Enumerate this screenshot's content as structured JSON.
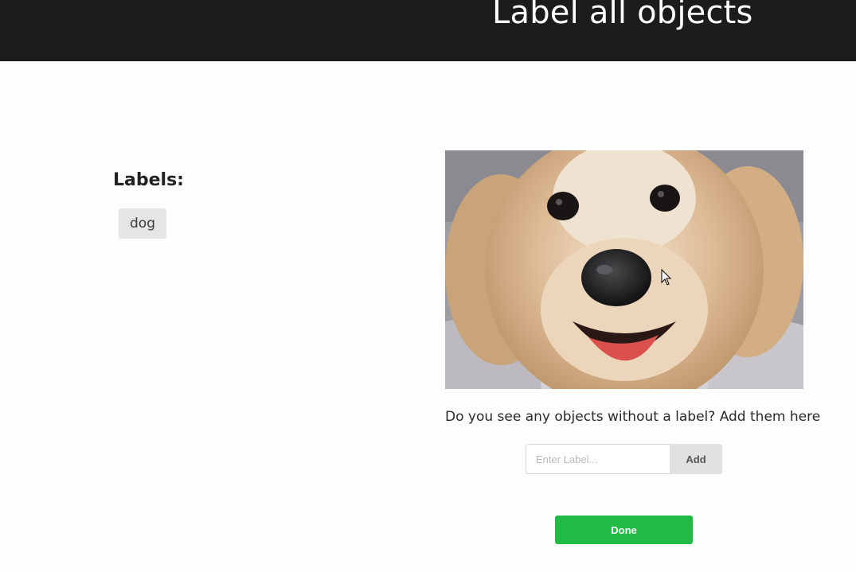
{
  "header": {
    "title": "Label all objects"
  },
  "labels_panel": {
    "heading": "Labels:",
    "labels": [
      "dog"
    ]
  },
  "image": {
    "subject": "golden retriever puppy face"
  },
  "add_label": {
    "prompt": "Do you see any objects without a label? Add them here",
    "placeholder": "Enter Label...",
    "value": "",
    "button_label": "Add"
  },
  "actions": {
    "done_label": "Done"
  },
  "colors": {
    "header_bg": "#1b1c1d",
    "done_green": "#21ba45",
    "chip_bg": "#e4e5e6"
  },
  "icons": {
    "cursor": "mouse-pointer-icon"
  }
}
